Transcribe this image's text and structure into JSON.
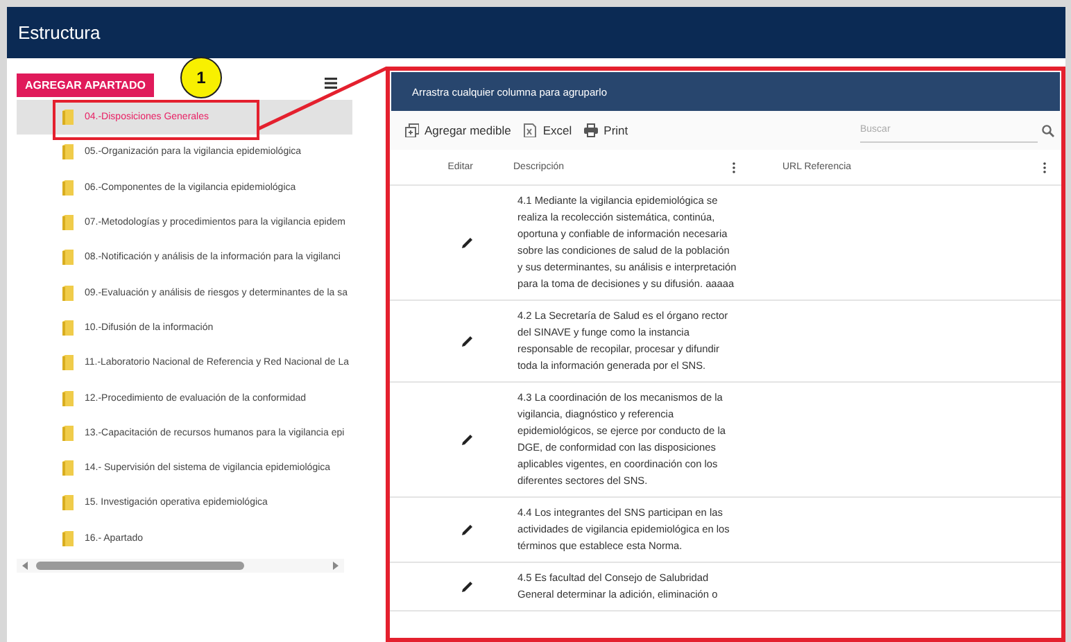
{
  "window": {
    "title": "Estructura"
  },
  "add_button": {
    "label": "AGREGAR APARTADO"
  },
  "callout": {
    "label": "1"
  },
  "tree": {
    "items": [
      {
        "label": "04.-Disposiciones Generales",
        "selected": true
      },
      {
        "label": "05.-Organización para la vigilancia epidemiológica",
        "selected": false
      },
      {
        "label": "06.-Componentes de la vigilancia epidemiológica",
        "selected": false
      },
      {
        "label": "07.-Metodologías y procedimientos para la vigilancia epidem",
        "selected": false
      },
      {
        "label": "08.-Notificación y análisis de la información para la vigilanci",
        "selected": false
      },
      {
        "label": "09.-Evaluación y análisis de riesgos y determinantes de la sa",
        "selected": false
      },
      {
        "label": "10.-Difusión de la información",
        "selected": false
      },
      {
        "label": "11.-Laboratorio Nacional de Referencia y Red Nacional de La",
        "selected": false
      },
      {
        "label": "12.-Procedimiento de evaluación de la conformidad",
        "selected": false
      },
      {
        "label": "13.-Capacitación de recursos humanos para la vigilancia epi",
        "selected": false
      },
      {
        "label": "14.- Supervisión del sistema de vigilancia epidemiológica",
        "selected": false
      },
      {
        "label": "15. Investigación operativa epidemiológica",
        "selected": false
      },
      {
        "label": "16.- Apartado",
        "selected": false
      }
    ]
  },
  "grid": {
    "group_hint": "Arrastra cualquier columna para agruparlo",
    "toolbar": [
      {
        "kind": "add",
        "label": "Agregar medible"
      },
      {
        "kind": "excel",
        "label": "Excel"
      },
      {
        "kind": "print",
        "label": "Print"
      }
    ],
    "search": {
      "placeholder": "Buscar"
    },
    "columns": [
      "Editar",
      "Descripción",
      "URL Referencia"
    ],
    "rows": [
      {
        "description": "4.1 Mediante la vigilancia epidemiológica se realiza la recolección sistemática, continúa, oportuna y confiable de información necesaria sobre las condiciones de salud de la población y sus determinantes, su análisis e interpretación para la toma de decisiones y su difusión. aaaaa"
      },
      {
        "description": "4.2 La Secretaría de Salud es el órgano rector del SINAVE y funge como la instancia responsable de recopilar, procesar y difundir toda la información generada por el SNS."
      },
      {
        "description": "4.3 La coordinación de los mecanismos de la vigilancia, diagnóstico y referencia epidemiológicos, se ejerce por conducto de la DGE, de conformidad con las disposiciones aplicables vigentes, en coordinación con los diferentes sectores del SNS."
      },
      {
        "description": "4.4 Los integrantes del SNS participan en las actividades de vigilancia epidemiológica en los términos que establece esta Norma."
      },
      {
        "description": "4.5 Es facultad del Consejo de Salubridad General determinar la adición, eliminación o"
      }
    ]
  }
}
